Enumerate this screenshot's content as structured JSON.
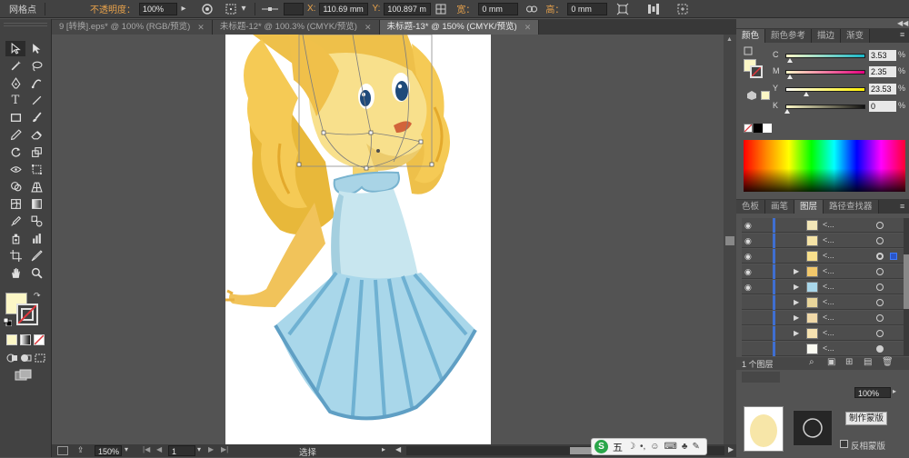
{
  "control_bar": {
    "label_mesh_point": "网格点",
    "label_opacity": "不透明度：",
    "opacity_value": "100%",
    "label_x": "X:",
    "x_value": "110.69 mm",
    "label_y": "Y:",
    "y_value": "100.897 m",
    "label_w": "宽：",
    "w_value": "0 mm",
    "label_h": "高：",
    "h_value": "0 mm"
  },
  "tabs": [
    {
      "label": "9 [转换].eps* @ 100% (RGB/预览)"
    },
    {
      "label": "未标题-12* @ 100.3% (CMYK/预览)"
    },
    {
      "label": "未标题-13* @ 150% (CMYK/预览)",
      "active": true
    }
  ],
  "status_bar": {
    "zoom": "150%",
    "page": "1",
    "mode": "选择"
  },
  "color_panel": {
    "tabs": [
      "颜色",
      "颜色参考",
      "描边",
      "渐变"
    ],
    "sliders": [
      {
        "letter": "C",
        "value": "3.53",
        "unit": "%",
        "fraction": 0.035
      },
      {
        "letter": "M",
        "value": "2.35",
        "unit": "%",
        "fraction": 0.024
      },
      {
        "letter": "Y",
        "value": "23.53",
        "unit": "%",
        "fraction": 0.235
      },
      {
        "letter": "K",
        "value": "0",
        "unit": "%",
        "fraction": 0.0
      }
    ],
    "fill_color": "#fcf7c6"
  },
  "layers_panel": {
    "tabs": [
      "色板",
      "画笔",
      "图层",
      "路径查找器"
    ],
    "layer_count": "1 个图层",
    "rows": [
      {
        "name": "<...",
        "visible": true,
        "expandable": false,
        "selected": false
      },
      {
        "name": "<...",
        "visible": true,
        "expandable": false,
        "selected": false
      },
      {
        "name": "<...",
        "visible": true,
        "expandable": false,
        "selected": true
      },
      {
        "name": "<...",
        "visible": true,
        "expandable": true,
        "selected": false
      },
      {
        "name": "<...",
        "visible": true,
        "expandable": true,
        "selected": false
      },
      {
        "name": "<...",
        "visible": false,
        "expandable": true,
        "selected": false
      },
      {
        "name": "<...",
        "visible": false,
        "expandable": true,
        "selected": false
      },
      {
        "name": "<...",
        "visible": false,
        "expandable": true,
        "selected": false
      },
      {
        "name": "<...",
        "visible": false,
        "expandable": false,
        "selected": false
      }
    ]
  },
  "transparency_panel": {
    "opacity_value": "100%",
    "button_label": "制作蒙版",
    "checkbox_label": "反相蒙版"
  },
  "ime_bar": {
    "label": "五"
  },
  "colors": {
    "ui_dark": "#424242",
    "canvas": "#535353",
    "accent_orange": "#e8a24b",
    "layer_blue": "#3f6fd1"
  }
}
